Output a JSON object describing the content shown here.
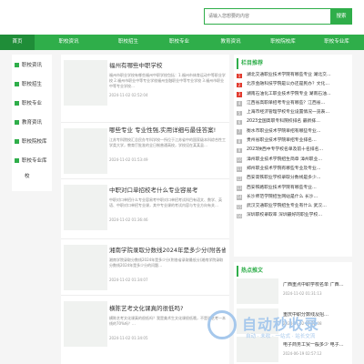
{
  "search": {
    "placeholder": "请输入您想要的内容",
    "button_label": "搜索"
  },
  "nav": {
    "items": [
      {
        "label": "首页",
        "active": true
      },
      {
        "label": "职校资讯",
        "active": false
      },
      {
        "label": "职校招生",
        "active": false
      },
      {
        "label": "职校专业",
        "active": false
      },
      {
        "label": "教育资讯",
        "active": false
      },
      {
        "label": "职校院校库",
        "active": false
      },
      {
        "label": "职校专业库",
        "active": false
      }
    ]
  },
  "sidebar": {
    "items": [
      {
        "label": "职校资讯"
      },
      {
        "label": "职校招生"
      },
      {
        "label": "职校专业"
      },
      {
        "label": "教育资讯"
      },
      {
        "label": "职校院校库"
      },
      {
        "label": "职校专业库"
      }
    ],
    "overflow": "校"
  },
  "articles": [
    {
      "title": "福州有哪些中职学校",
      "desc": "福州市职业学校有哪些福州中职学校包括：1.福州市体育运动中等职业学校 2.福州市职业中等专业学校福州金融职业中等专业学校 3.福州市职业中等专业学校…",
      "date": "2024-11-02 02:52:04"
    },
    {
      "title": "哪些专业 专业性强,实用详细与最佳答案!",
      "desc": "江苏专科院校汇总民办专科学校一所位于江苏省中的国家级本科综合性工学类大学，教育厅批准的全日制普通高校，学校设在某某县…",
      "date": "2024-11-02 01:53:49"
    },
    {
      "title": "中职对口单招校考什么专业容易考",
      "desc": "中职对口单招什么专业容易考中职对口单招考试科目有语文、数学、英语、中职对口单招专业课，其中专业课的考试内容与专业方向有关…",
      "date": "2024-11-02 01:36:46"
    },
    {
      "title": "湘南学院录取分数线2024年是多少分(附各省录取最低…",
      "desc": "湘南学院录取分数线2024年是多少分(附各省录取最低分)湘南学院录取分数线2024年是多少分的问题…",
      "date": "2024-11-02 01:34:07"
    },
    {
      "title": "横陈艺考文化课真的很低吗?",
      "desc": "横陈艺考文化课真的很低吗？我是美术生文化课很低哦，不是说艺考一本线的70%吗？…",
      "date": "2024-11-02 01:34:05"
    }
  ],
  "ranking": {
    "title": "栏目推荐",
    "items": [
      "湖北交通职业技术学院有哪些专业 湖北交…",
      "北京金融科技学院是公办还是民办？文化…",
      "湖南石油化工职业技术学院专业 湖南石油…",
      "江西省高职单招考专业有哪些？江西省…",
      "上海市经济管理学校专业设置情况一览表…",
      "2023全国高职专科院校排名 最新排…",
      "衡水市职业技术学院单招有哪些专业…",
      "贵州省职业技术学院单招专业排名…",
      "2023陕西中专学校名单及前十名排名…",
      "漳州职业技术学院招生简章 漳州职业…",
      "郑州职业技术学院有哪些专业及专业…",
      "西安高铁职业学校录取分数线是多少…",
      "西安铁路职业技术学院有哪些专业…",
      "长沙师范学院招生网站是什么 长沙…",
      "武汉交通职业学院招生专业有什么 武汉…",
      "深圳职校录取率 深圳最好的职业学校…"
    ]
  },
  "hot": {
    "title": "热点推文",
    "items": [
      {
        "title": "广西重点中职学校名单 广西…",
        "date": "2024-11-02 01:31:13"
      },
      {
        "title": "重庆中职分数线及招…",
        "date": "2024-11-02 01:32:08"
      },
      {
        "title": "电子商务工贸一般多少 电子…",
        "date": "2024-06-19 02:57:12"
      }
    ]
  },
  "watermark": {
    "main": "自动秒收录",
    "sub": "自动 · 未收 · 一站式 · 站长交流"
  },
  "colors": {
    "brand_green": "#2fae4a",
    "nav_active": "#1f8d38",
    "rank_hot": "#e23b2f",
    "watermark": "#a6c8ec"
  }
}
